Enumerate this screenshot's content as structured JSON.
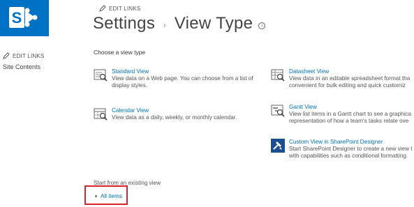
{
  "header": {
    "edit_links_label": "EDIT LINKS",
    "title": "Settings",
    "separator": "›",
    "subtitle": "View Type",
    "info_glyph": "i"
  },
  "sidebar": {
    "edit_links_label": "EDIT LINKS",
    "items": [
      {
        "label": "Site Contents"
      }
    ]
  },
  "main": {
    "choose_label": "Choose a view type",
    "view_types": [
      {
        "name": "Standard View",
        "line1": "View data on a Web page. You can choose from a list of",
        "line2": "display styles.",
        "icon": "standard-view-icon"
      },
      {
        "name": "Calendar View",
        "line1": "View data as a daily, weekly, or monthly calendar.",
        "line2": "",
        "icon": "calendar-view-icon"
      },
      {
        "name": "Datasheet View",
        "line1": "View data in an editable spreadsheet format tha",
        "line2": "convenient for bulk editing and quick customiz",
        "icon": "datasheet-view-icon"
      },
      {
        "name": "Gantt View",
        "line1": "View list items in a Gantt chart to see a graphica",
        "line2": "representation of how a team's tasks relate ove",
        "icon": "gantt-view-icon"
      },
      {
        "name": "Custom View in SharePoint Designer",
        "line1": "Start SharePoint Designer to create a new view t",
        "line2": "with capabilities such as conditional formatting.",
        "icon": "sharepoint-designer-icon"
      }
    ],
    "existing_label": "Start from an existing view",
    "existing_views": [
      {
        "label": "All items"
      }
    ]
  },
  "colors": {
    "brand": "#0072c6",
    "link": "#0072c6",
    "highlight_box": "#d9242b"
  }
}
